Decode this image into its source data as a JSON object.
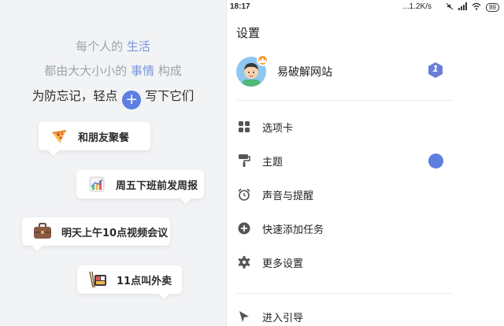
{
  "promo": {
    "line1_prefix": "每个人的 ",
    "line1_accent": "生活",
    "line2_prefix": "都由大大小小的 ",
    "line2_accent": "事情",
    "line2_suffix": " 构成",
    "line3_prefix": "为防忘记，轻点",
    "line3_suffix": "写下它们",
    "plus_glyph": "+",
    "cards": [
      {
        "icon": "pizza-icon",
        "text": "和朋友聚餐"
      },
      {
        "icon": "chart-notebook-icon",
        "text": "周五下班前发周报"
      },
      {
        "icon": "briefcase-icon",
        "text": "明天上午10点视频会议"
      },
      {
        "icon": "bento-box-icon",
        "text": "11点叫外卖"
      }
    ]
  },
  "status_bar": {
    "time": "18:17",
    "network": "...1.2K/s",
    "icons": [
      "mute-icon",
      "signal-icon",
      "wifi-icon",
      "battery-icon"
    ],
    "battery": "89"
  },
  "settings": {
    "title": "设置",
    "user": {
      "avatar": "avatar-icon",
      "badge": "crown-icon",
      "name": "易破解网站",
      "level": "1"
    },
    "items": [
      {
        "icon": "tabs-grid-icon",
        "label": "选项卡"
      },
      {
        "icon": "paint-roller-icon",
        "label": "主题"
      },
      {
        "icon": "alarm-clock-icon",
        "label": "声音与提醒"
      },
      {
        "icon": "add-circle-icon",
        "label": "快速添加任务"
      },
      {
        "icon": "gear-icon",
        "label": "更多设置"
      },
      {
        "icon": "guide-icon",
        "label": "进入引导"
      }
    ],
    "colors": {
      "accent": "#5c7fe0",
      "level_badge": "#6a7fd8",
      "crown": "#f39a36"
    }
  }
}
